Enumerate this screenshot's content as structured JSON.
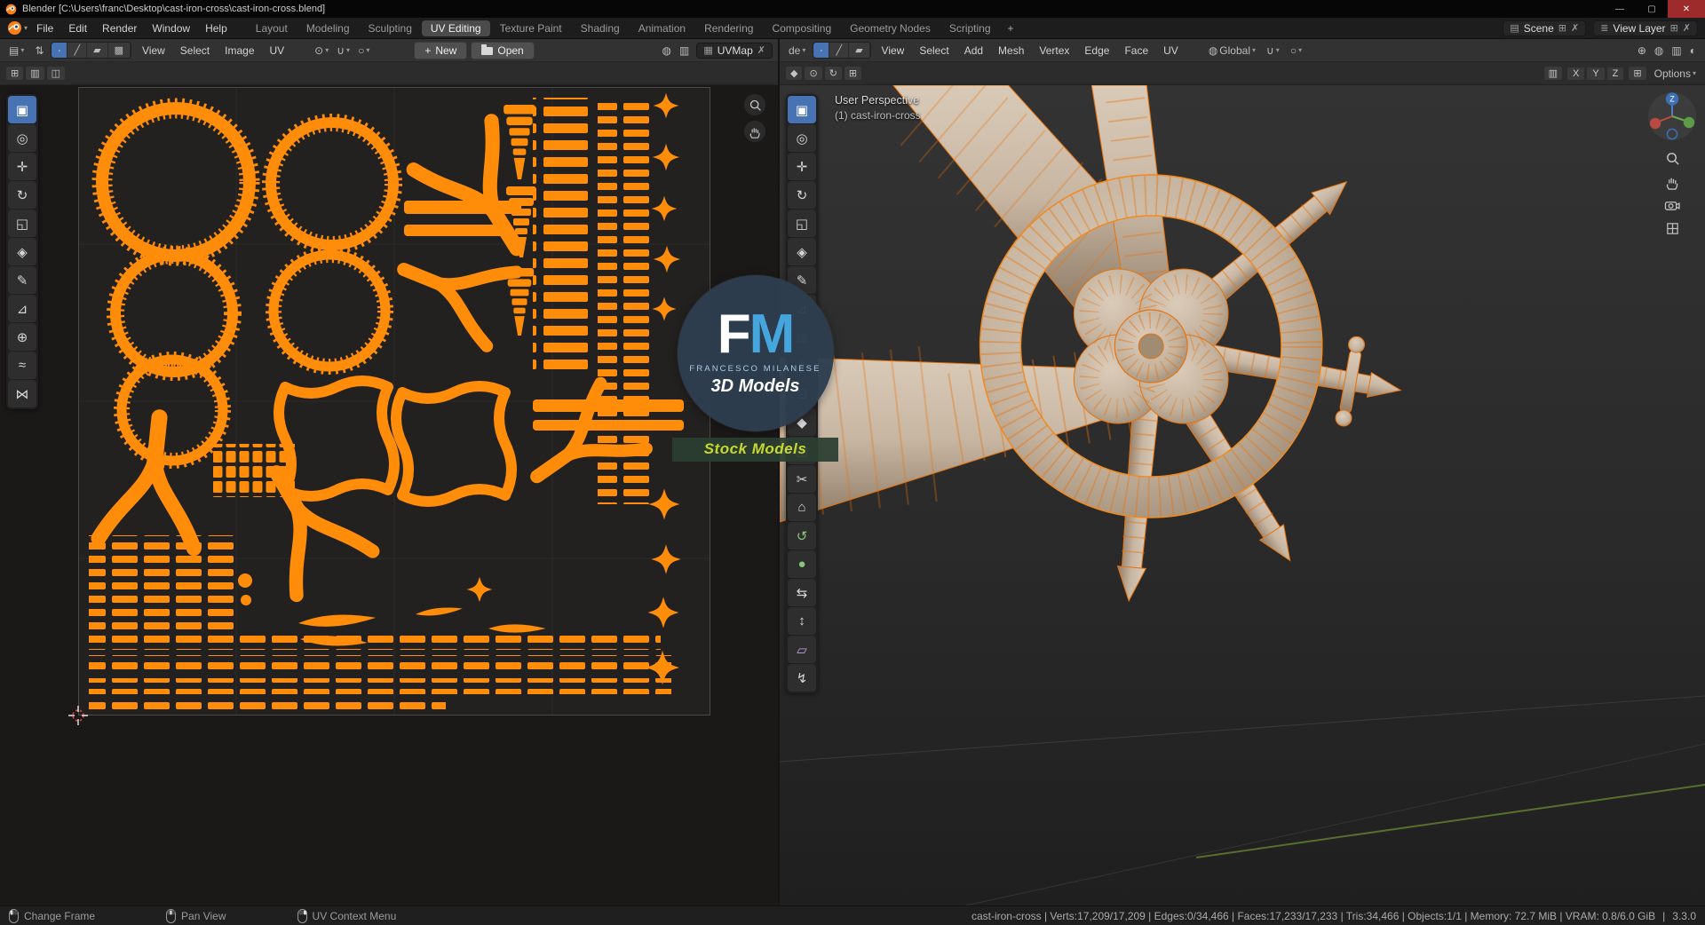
{
  "ui": {
    "caret_down": "▾",
    "separator": "|"
  },
  "colors": {
    "uv_orange": "#ff8d0a",
    "wire_orange": "#e8720c",
    "model_tan": "#c6b5a1",
    "accent_blue": "#4772b3",
    "banner_green": "#c6d82f",
    "watermark_blue": "#45a5dd"
  },
  "window": {
    "title": "Blender [C:\\Users\\franc\\Desktop\\cast-iron-cross\\cast-iron-cross.blend]",
    "controls": {
      "minimize": "—",
      "maximize": "▢",
      "close": "✕"
    }
  },
  "menubar": {
    "menus": [
      "File",
      "Edit",
      "Render",
      "Window",
      "Help"
    ],
    "workspaces": [
      {
        "label": "Layout"
      },
      {
        "label": "Modeling"
      },
      {
        "label": "Sculpting"
      },
      {
        "label": "UV Editing",
        "active": true
      },
      {
        "label": "Texture Paint"
      },
      {
        "label": "Shading"
      },
      {
        "label": "Animation"
      },
      {
        "label": "Rendering"
      },
      {
        "label": "Compositing"
      },
      {
        "label": "Geometry Nodes"
      },
      {
        "label": "Scripting"
      }
    ],
    "add_tab": "+",
    "scene": {
      "icon": "▤",
      "label": "Scene",
      "new_icon": "⊞",
      "close_icon": "✗"
    },
    "view_layer": {
      "icon": "≣",
      "label": "View Layer",
      "new_icon": "⊞",
      "close_icon": "✗"
    }
  },
  "uv_editor": {
    "editor_icon": {
      "glyph": "▤"
    },
    "sync_icon": {
      "glyph": "⇅"
    },
    "select_modes": [
      {
        "name": "uv-vertex-select-button",
        "glyph": "∙",
        "active": true
      },
      {
        "name": "uv-edge-select-button",
        "glyph": "╱"
      },
      {
        "name": "uv-face-select-button",
        "glyph": "▰"
      },
      {
        "name": "uv-island-select-button",
        "glyph": "▩"
      }
    ],
    "menus": [
      "View",
      "Select",
      "Image",
      "UV"
    ],
    "mid_icons": [
      {
        "name": "pivot-point-icon",
        "glyph": "⊙"
      },
      {
        "name": "snap-magnet-icon",
        "glyph": "∪"
      },
      {
        "name": "proportional-editing-icon",
        "glyph": "○"
      }
    ],
    "new_button": {
      "icon": "+",
      "label": "New"
    },
    "open_button": {
      "label": "Open"
    },
    "right_icons": [
      {
        "name": "gizmos-toggle-icon",
        "glyph": "◍"
      },
      {
        "name": "overlays-toggle-icon",
        "glyph": "▥"
      }
    ],
    "uvmap": {
      "icon": "▦",
      "label": "UVMap",
      "close": "✗"
    },
    "row2_icons": [
      {
        "name": "uv-paint-mask-icon",
        "glyph": "⊞"
      },
      {
        "name": "uv-stencil-icon",
        "glyph": "▥"
      },
      {
        "name": "uv-clip-icon",
        "glyph": "◫"
      }
    ],
    "float_nav": [
      "zoom-icon",
      "pan-hand-icon"
    ],
    "tools": [
      {
        "name": "uv-select-box-tool",
        "glyph": "▣",
        "active": true
      },
      {
        "name": "uv-cursor-tool",
        "glyph": "◎"
      },
      {
        "name": "uv-move-tool",
        "glyph": "✛"
      },
      {
        "name": "uv-rotate-tool",
        "glyph": "↻"
      },
      {
        "name": "uv-scale-tool",
        "glyph": "◱"
      },
      {
        "name": "uv-transform-tool",
        "glyph": "◈"
      },
      {
        "name": "uv-annotate-tool",
        "glyph": "✎"
      },
      {
        "name": "uv-measure-tool",
        "glyph": "⊿"
      },
      {
        "name": "uv-grab-tool",
        "glyph": "⊕"
      },
      {
        "name": "uv-relax-tool",
        "glyph": "≈"
      },
      {
        "name": "uv-pinch-tool",
        "glyph": "⋈"
      }
    ]
  },
  "view3d": {
    "mode_truncated": "de",
    "select_modes": [
      {
        "name": "vertex-mode-button",
        "glyph": "∙",
        "active": true
      },
      {
        "name": "edge-mode-button",
        "glyph": "╱"
      },
      {
        "name": "face-mode-button",
        "glyph": "▰"
      }
    ],
    "menus": [
      "View",
      "Select",
      "Add",
      "Mesh",
      "Vertex",
      "Edge",
      "Face",
      "UV"
    ],
    "orientation": {
      "icon": "◍",
      "label": "Global"
    },
    "snap_icon": "∪",
    "prop_icon": "○",
    "right_icons": [
      {
        "name": "show-gizmo-icon",
        "glyph": "⊕"
      },
      {
        "name": "show-overlays-icon",
        "glyph": "◍"
      },
      {
        "name": "xray-toggle-icon",
        "glyph": "▥"
      },
      {
        "name": "shading-mode-icon",
        "glyph": "◐"
      }
    ],
    "row2_left_icons": [
      {
        "name": "transform-pivot-icon",
        "glyph": "◆"
      },
      {
        "name": "snap-target-icon",
        "glyph": "⊙"
      },
      {
        "name": "proportional-falloff-icon",
        "glyph": "↻"
      },
      {
        "name": "auto-merge-icon",
        "glyph": "⊞"
      }
    ],
    "row2_icon_a": "▥",
    "row2_icon_b": "⊞",
    "mirror_axes": [
      "X",
      "Y",
      "Z"
    ],
    "options_label": "Options",
    "overlay": {
      "line1": "User Perspective",
      "line2": "(1) cast-iron-cross"
    },
    "gizmo_axis_label": "Z",
    "nav_icons": [
      "zoom-icon",
      "pan-hand-icon",
      "camera-view-icon",
      "ortho-grid-icon"
    ],
    "tools": [
      {
        "name": "select-box-tool",
        "glyph": "▣",
        "active": true
      },
      {
        "name": "cursor-tool",
        "glyph": "◎"
      },
      {
        "name": "move-tool",
        "glyph": "✛"
      },
      {
        "name": "rotate-tool",
        "glyph": "↻"
      },
      {
        "name": "scale-tool",
        "glyph": "◱"
      },
      {
        "name": "transform-tool",
        "glyph": "◈"
      },
      {
        "name": "annotate-tool",
        "glyph": "✎"
      },
      {
        "name": "measure-tool",
        "glyph": "⊿"
      },
      {
        "name": "add-cube-tool",
        "glyph": "▦",
        "color": "#8cc47c"
      },
      {
        "name": "extrude-region-tool",
        "glyph": "⇧"
      },
      {
        "name": "inset-faces-tool",
        "glyph": "⊡"
      },
      {
        "name": "bevel-tool",
        "glyph": "◆"
      },
      {
        "name": "loop-cut-tool",
        "glyph": "◫"
      },
      {
        "name": "knife-tool",
        "glyph": "✂"
      },
      {
        "name": "poly-build-tool",
        "glyph": "⌂"
      },
      {
        "name": "spin-tool",
        "glyph": "↺",
        "color": "#8cc47c"
      },
      {
        "name": "smooth-tool",
        "glyph": "●",
        "color": "#8cc47c"
      },
      {
        "name": "edge-slide-tool",
        "glyph": "⇆"
      },
      {
        "name": "shrink-fatten-tool",
        "glyph": "↕"
      },
      {
        "name": "shear-tool",
        "glyph": "▱",
        "color": "#c0a8e0"
      },
      {
        "name": "rip-region-tool",
        "glyph": "↯"
      }
    ]
  },
  "watermark": {
    "initial_f": "F",
    "initial_m": "M",
    "name": "FRANCESCO MILANESE",
    "tagline": "3D Models",
    "banner": "Stock Models"
  },
  "statusbar": {
    "hints": [
      {
        "label": "Change Frame",
        "button": "left"
      },
      {
        "label": "Pan View",
        "button": "middle"
      },
      {
        "label": "UV Context Menu",
        "button": "right"
      }
    ],
    "stats": "cast-iron-cross | Verts:17,209/17,209 | Edges:0/34,466 | Faces:17,233/17,233 | Tris:34,466 | Objects:1/1 | Memory: 72.7 MiB | VRAM: 0.8/6.0 GiB",
    "version": "3.3.0"
  }
}
